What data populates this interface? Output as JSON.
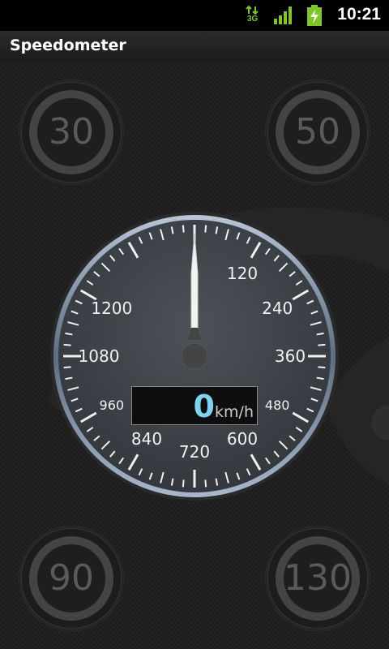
{
  "status_bar": {
    "time": "10:21",
    "network_label": "3G",
    "icons": [
      "network-3g-icon",
      "signal-icon",
      "battery-charging-icon"
    ],
    "accent_color": "#7ec623"
  },
  "app": {
    "title": "Speedometer"
  },
  "speed_limits": [
    {
      "value": "30"
    },
    {
      "value": "50"
    },
    {
      "value": "90"
    },
    {
      "value": "130"
    }
  ],
  "gauge": {
    "labels": [
      "120",
      "240",
      "360",
      "480",
      "600",
      "720",
      "840",
      "960",
      "1080",
      "1200"
    ],
    "scale_max": 1440,
    "needle_value": 0,
    "readout": {
      "value": "0",
      "unit": "km/h"
    },
    "colors": {
      "dial_face": "#444a50",
      "bezel": "#8aa0b8",
      "readout_value": "#7dd3f0"
    }
  }
}
